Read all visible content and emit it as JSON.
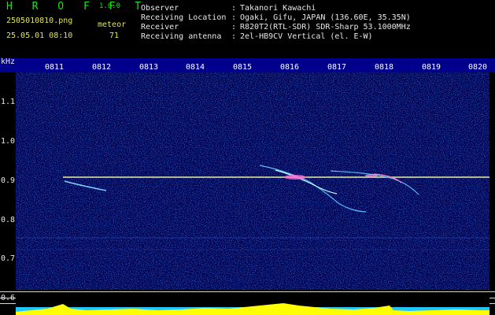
{
  "header": {
    "app_name": "H R O F F T",
    "version": "1.0.0",
    "filename": "2505010810.png",
    "datetime": "25.05.01 08:10",
    "meteor_label": "meteor",
    "meteor_count": "71"
  },
  "info": {
    "rows": [
      {
        "key": "Observer",
        "sep": ":",
        "value": "Takanori Kawachi"
      },
      {
        "key": "Receiving Location",
        "sep": ":",
        "value": "Ogaki, Gifu, JAPAN (136.60E, 35.35N)"
      },
      {
        "key": "Receiver",
        "sep": ":",
        "value": "R820T2(RTL-SDR) SDR-Sharp 53.1000MHz"
      },
      {
        "key": "Receiving antenna",
        "sep": ":",
        "value": "2el-HB9CV Vertical (el. E-W)"
      }
    ]
  },
  "axes": {
    "y_unit": "kHz",
    "y_ticks": [
      "1.1",
      "1.0",
      "0.9",
      "0.8",
      "0.7",
      "0.6"
    ],
    "x_ticks": [
      "0811",
      "0812",
      "0813",
      "0814",
      "0815",
      "0816",
      "0817",
      "0818",
      "0819",
      "0820"
    ]
  },
  "colors": {
    "background": "#00005a",
    "carrier": "#f0f08a",
    "meter_yellow": "#ffff00",
    "meter_cyan": "#20c8ff"
  }
}
